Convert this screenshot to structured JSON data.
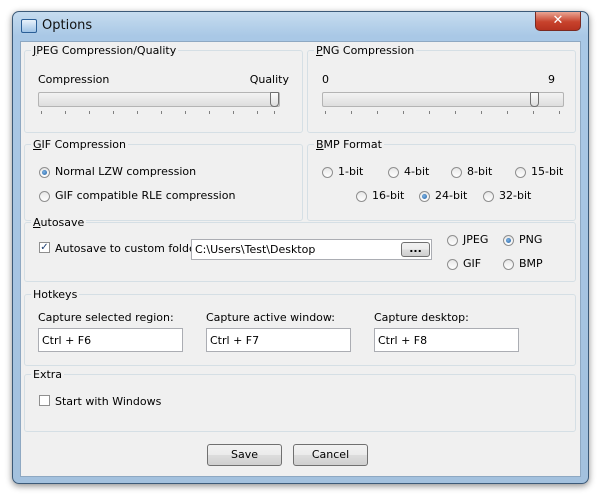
{
  "window": {
    "title": "Options",
    "close_glyph": "✕"
  },
  "jpeg": {
    "legend_underline": "J",
    "legend_rest": "PEG Compression/Quality",
    "left_label": "Compression",
    "right_label": "Quality",
    "slider_value": 1.0
  },
  "png": {
    "legend_underline": "P",
    "legend_rest": "NG Compression",
    "min_label": "0",
    "max_label": "9",
    "slider_value": 9
  },
  "gif": {
    "legend_underline": "G",
    "legend_rest": "IF Compression",
    "options": [
      {
        "label": "Normal LZW compression",
        "selected": true
      },
      {
        "label": "GIF compatible RLE compression",
        "selected": false
      }
    ]
  },
  "bmp": {
    "legend_underline": "B",
    "legend_rest": "MP Format",
    "options": [
      {
        "label": "1-bit",
        "selected": false
      },
      {
        "label": "4-bit",
        "selected": false
      },
      {
        "label": "8-bit",
        "selected": false
      },
      {
        "label": "15-bit",
        "selected": false
      },
      {
        "label": "16-bit",
        "selected": false
      },
      {
        "label": "24-bit",
        "selected": true
      },
      {
        "label": "32-bit",
        "selected": false
      }
    ]
  },
  "autosave": {
    "legend_underline": "A",
    "legend_rest": "utosave",
    "checkbox_label": "Autosave to custom folder",
    "checked": true,
    "folder": "C:\\Users\\Test\\Desktop",
    "browse_label": "...",
    "formats": [
      {
        "label": "JPEG",
        "selected": false
      },
      {
        "label": "PNG",
        "selected": true
      },
      {
        "label": "GIF",
        "selected": false
      },
      {
        "label": "BMP",
        "selected": false
      }
    ]
  },
  "hotkeys": {
    "legend": "Hotkeys",
    "items": [
      {
        "label": "Capture selected region:",
        "value": "Ctrl + F6"
      },
      {
        "label": "Capture active window:",
        "value": "Ctrl + F7"
      },
      {
        "label": "Capture desktop:",
        "value": "Ctrl + F8"
      }
    ]
  },
  "extra": {
    "legend": "Extra",
    "start_with_windows_label": "Start with Windows",
    "start_with_windows_checked": false
  },
  "buttons": {
    "save": "Save",
    "cancel": "Cancel"
  }
}
